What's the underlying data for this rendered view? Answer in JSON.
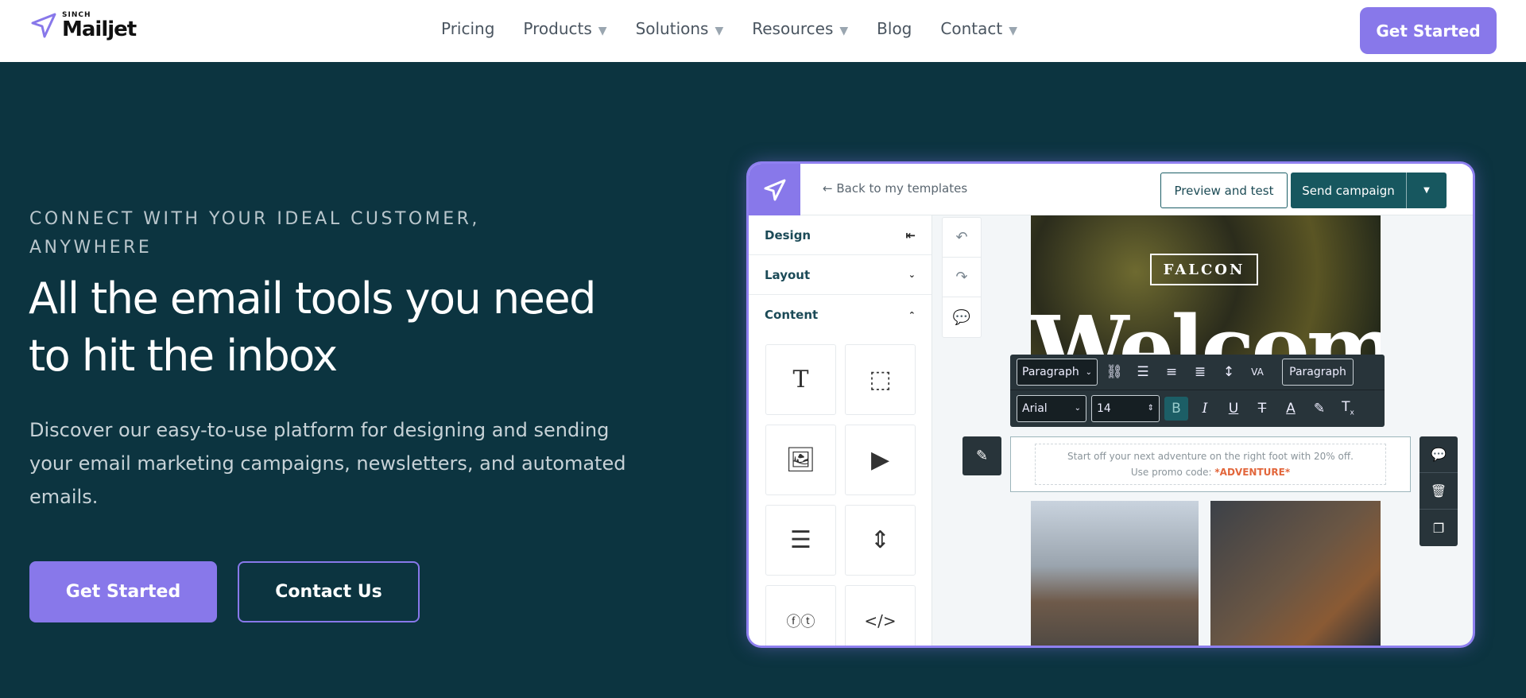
{
  "nav": {
    "brand_small": "SINCH",
    "brand": "Mailjet",
    "links": [
      {
        "label": "Pricing",
        "dropdown": false
      },
      {
        "label": "Products",
        "dropdown": true
      },
      {
        "label": "Solutions",
        "dropdown": true
      },
      {
        "label": "Resources",
        "dropdown": true
      },
      {
        "label": "Blog",
        "dropdown": false
      },
      {
        "label": "Contact",
        "dropdown": true
      }
    ],
    "cta": "Get Started"
  },
  "hero": {
    "eyebrow": "CONNECT WITH YOUR IDEAL CUSTOMER, ANYWHERE",
    "title": "All the email tools you need to hit the inbox",
    "description": "Discover our easy-to-use platform for designing and sending your email marketing campaigns, newsletters, and automated emails.",
    "primary": "Get Started",
    "secondary": "Contact Us"
  },
  "editor": {
    "back": "Back to my templates",
    "preview": "Preview and test",
    "send": "Send campaign",
    "panel": {
      "design": "Design",
      "layout": "Layout",
      "content": "Content"
    },
    "email": {
      "brand": "FALCON",
      "headline": "Welcome",
      "line1": "Start off your next adventure on the right foot with 20% off.",
      "promo_label": "Use promo code: ",
      "promo_code": "*ADVENTURE*"
    },
    "toolbar": {
      "block_style": "Paragraph",
      "style_button": "Paragraph",
      "font": "Arial",
      "size": "14"
    }
  },
  "colors": {
    "accent": "#8878ea",
    "hero_bg": "#0c3440",
    "teal": "#17575f",
    "promo": "#e2663b"
  }
}
